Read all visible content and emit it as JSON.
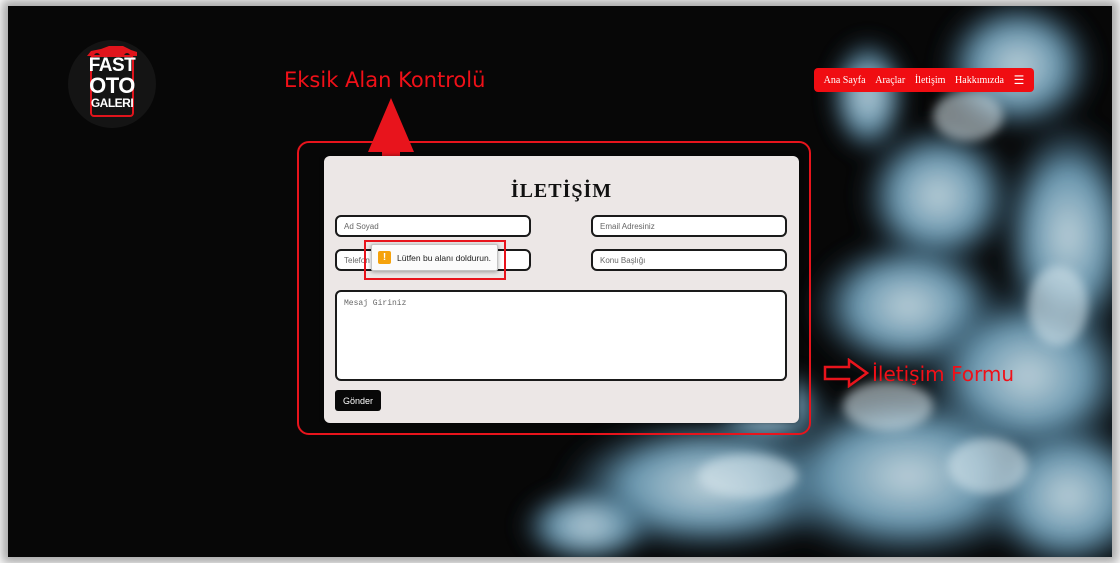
{
  "logo": {
    "line1": "FAST",
    "line2": "OTO",
    "line3": "GALERI"
  },
  "nav": {
    "items": [
      "Ana Sayfa",
      "Araçlar",
      "İletişim",
      "Hakkımızda"
    ],
    "menu_icon": "hamburger-menu-icon"
  },
  "annotations": {
    "missing_field": "Eksik Alan Kontrolü",
    "contact_form": "İletişim Formu"
  },
  "form": {
    "title": "İLETİŞİM",
    "name_placeholder": "Ad Soyad",
    "email_placeholder": "Email Adresiniz",
    "phone_placeholder": "Telefon",
    "subject_placeholder": "Konu Başlığı",
    "message_placeholder": "Mesaj Giriniz",
    "submit_label": "Gönder"
  },
  "validation": {
    "message": "Lütfen bu alanı doldurun.",
    "icon": "warning-icon"
  },
  "colors": {
    "accent": "#f00d12",
    "background": "#070707",
    "card": "#ece7e6",
    "smoke": "#6fa0b8"
  }
}
